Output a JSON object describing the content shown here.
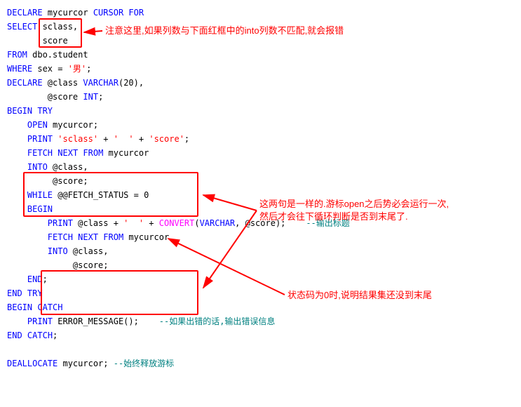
{
  "code": {
    "l0_a": "DECLARE",
    "l0_b": " mycurcor ",
    "l0_c": "CURSOR",
    "l0_d": "FOR",
    "l1_a": "SELECT",
    "l1_b": " sclass,",
    "l2_a": "       score",
    "l3_a": "FROM",
    "l3_b": " dbo.student",
    "l4_a": "WHERE",
    "l4_b": " sex = ",
    "l4_c": "'男'",
    "l4_d": ";",
    "l5_a": "DECLARE",
    "l5_b": " @class ",
    "l5_c": "VARCHAR",
    "l5_d": "(",
    "l5_e": "20",
    "l5_f": "),",
    "l6_a": "        @score ",
    "l6_b": "INT",
    "l6_c": ";",
    "l7_a": "BEGIN",
    "l7_b": "TRY",
    "l8_a": "OPEN",
    "l8_b": " mycurcor;",
    "l9_a": "PRINT",
    "l9_b": "'sclass'",
    "l9_c": " + ",
    "l9_d": "'  '",
    "l9_e": " + ",
    "l9_f": "'score'",
    "l9_g": ";",
    "l10_a": "FETCH",
    "l10_b": "NEXT",
    "l10_c": "FROM",
    "l10_d": " mycurcor",
    "l11_a": "INTO",
    "l11_b": " @class,",
    "l12_a": "         @score;",
    "l13_a": "WHILE",
    "l13_b": " @@FETCH_STATUS = ",
    "l13_c": "0",
    "l14_a": "BEGIN",
    "l15_a": "PRINT",
    "l15_b": " @class + ",
    "l15_c": "'  '",
    "l15_d": " + ",
    "l15_e": "CONVERT",
    "l15_f": "(",
    "l15_g": "VARCHAR",
    "l15_h": ", @score);    ",
    "l15_i": "--输出标题",
    "l16_a": "FETCH",
    "l16_b": "NEXT",
    "l16_c": "FROM",
    "l16_d": " mycurcor",
    "l17_a": "INTO",
    "l17_b": " @class,",
    "l18_a": "             @score;",
    "l19_a": "END",
    "l19_b": ";",
    "l20_a": "END",
    "l20_b": "TRY",
    "l21_a": "BEGIN",
    "l21_b": "CATCH",
    "l22_a": "PRINT",
    "l22_b": " ERROR_MESSAGE();    ",
    "l22_c": "--如果出错的话,输出错误信息",
    "l23_a": "END",
    "l23_b": "CATCH",
    "l23_c": ";",
    "l24_blank": " ",
    "l25_a": "DEALLOCATE",
    "l25_b": " mycurcor; ",
    "l25_c": "--始终释放游标"
  },
  "notes": {
    "n1": "注意这里,如果列数与下面红框中的into列数不匹配,就会报错",
    "n2a": "这两句是一样的.游标open之后势必会运行一次,",
    "n2b": "然后才会往下循环判断是否到末尾了.",
    "n3": "状态码为0时,说明结果集还没到末尾"
  }
}
